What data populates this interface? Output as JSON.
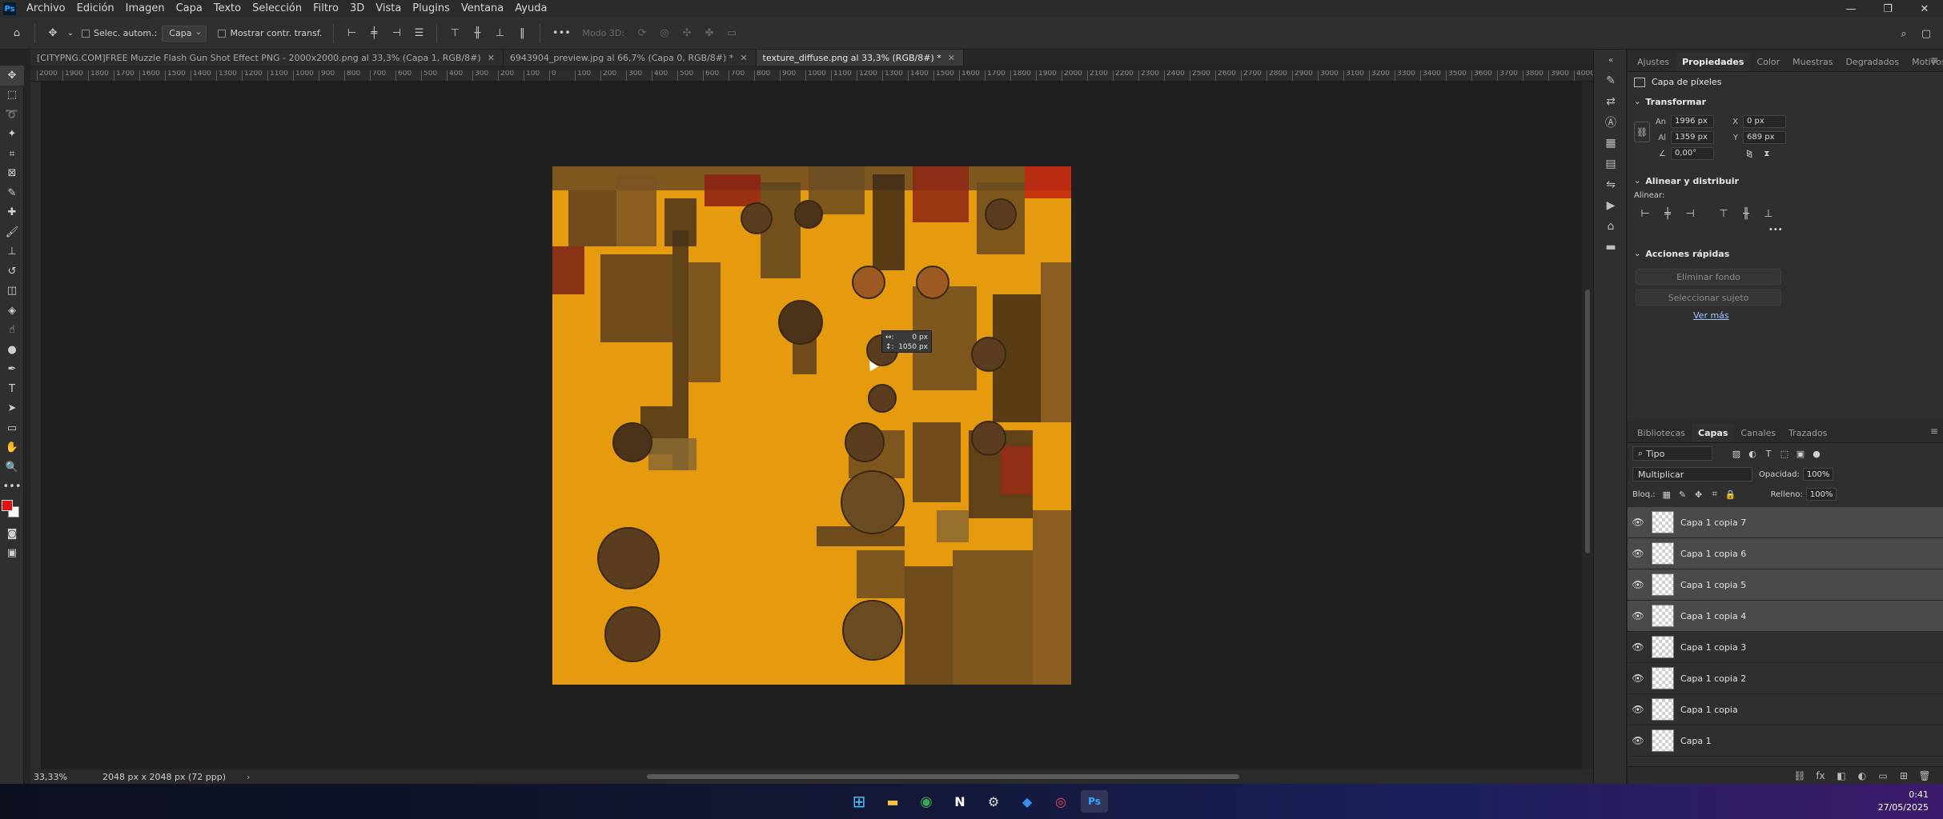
{
  "app": {
    "logo_text": "Ps",
    "menu": [
      "Archivo",
      "Edición",
      "Imagen",
      "Capa",
      "Texto",
      "Selección",
      "Filtro",
      "3D",
      "Vista",
      "Plugins",
      "Ventana",
      "Ayuda"
    ],
    "window_controls": {
      "minimize": "—",
      "restore": "❐",
      "close": "✕"
    }
  },
  "options": {
    "auto_select_label": "Selec. autom.:",
    "auto_select_value": "Capa",
    "show_transform_label": "Mostrar contr. transf.",
    "mode_3d_label": "Modo 3D:",
    "more": "•••"
  },
  "tabs": [
    {
      "label": "[CITYPNG.COM]FREE Muzzle Flash Gun Shot Effect PNG - 2000x2000.png al 33,3% (Capa 1, RGB/8#)",
      "active": false
    },
    {
      "label": "6943904_preview.jpg al 66,7% (Capa 0, RGB/8#) *",
      "active": false
    },
    {
      "label": "texture_diffuse.png al 33,3% (RGB/8#) *",
      "active": true
    }
  ],
  "tab_close": "✕",
  "ruler": {
    "top_labels": [
      "2000",
      "1900",
      "1800",
      "1700",
      "1600",
      "1500",
      "1400",
      "1300",
      "1200",
      "1100",
      "1000",
      "900",
      "800",
      "700",
      "600",
      "500",
      "400",
      "300",
      "200",
      "100",
      "0",
      "100",
      "200",
      "300",
      "400",
      "500",
      "600",
      "700",
      "800",
      "900",
      "1000",
      "1100",
      "1200",
      "1300",
      "1400",
      "1500",
      "1600",
      "1700",
      "1800",
      "1900",
      "2000",
      "2100",
      "2200",
      "2300",
      "2400",
      "2500",
      "2600",
      "2700",
      "2800",
      "2900",
      "3000",
      "3100",
      "3200",
      "3300",
      "3400",
      "3500",
      "3600",
      "3700",
      "3800",
      "3900",
      "4000"
    ]
  },
  "tooltip": {
    "line1_label": "↔:",
    "line1_value": "0 px",
    "line2_label": "↕:",
    "line2_value": "1050 px"
  },
  "status": {
    "zoom": "33,33%",
    "doc_info": "2048 px x 2048 px (72 ppp)",
    "arrow": "›"
  },
  "colors": {
    "foreground": "#e0100f",
    "background": "#ffffff",
    "texture_base": "#e59b0d"
  },
  "properties": {
    "tabs": [
      "Ajustes",
      "Propiedades",
      "Color",
      "Muestras",
      "Degradados",
      "Motivos"
    ],
    "active_tab": "Propiedades",
    "layer_type": "Capa de píxeles",
    "transform": {
      "title": "Transformar",
      "w_label": "An",
      "w_value": "1996 px",
      "h_label": "Al",
      "h_value": "1359 px",
      "x_label": "X",
      "x_value": "0 px",
      "y_label": "Y",
      "y_value": "689 px",
      "angle_value": "0,00°"
    },
    "align": {
      "title": "Alinear y distribuir",
      "subtitle": "Alinear:",
      "more": "•••"
    },
    "quick_actions": {
      "title": "Acciones rápidas",
      "remove_bg": "Eliminar fondo",
      "select_subject": "Seleccionar sujeto",
      "more_link": "Ver más"
    }
  },
  "layers": {
    "tabs": [
      "Bibliotecas",
      "Capas",
      "Canales",
      "Trazados"
    ],
    "active_tab": "Capas",
    "filter_label": "Tipo",
    "blend_mode": "Multiplicar",
    "opacity_label": "Opacidad:",
    "opacity_value": "100%",
    "lock_label": "Bloq.:",
    "fill_label": "Relleno:",
    "fill_value": "100%",
    "items": [
      {
        "name": "Capa 1 copia 7",
        "selected": true
      },
      {
        "name": "Capa 1 copia 6",
        "selected": true
      },
      {
        "name": "Capa 1 copia 5",
        "selected": true
      },
      {
        "name": "Capa 1 copia 4",
        "selected": true
      },
      {
        "name": "Capa 1 copia 3",
        "selected": false
      },
      {
        "name": "Capa 1 copia 2",
        "selected": false
      },
      {
        "name": "Capa 1 copia",
        "selected": false
      },
      {
        "name": "Capa 1",
        "selected": false
      }
    ]
  },
  "taskbar": {
    "time": "0:41",
    "date": "27/05/2025"
  }
}
